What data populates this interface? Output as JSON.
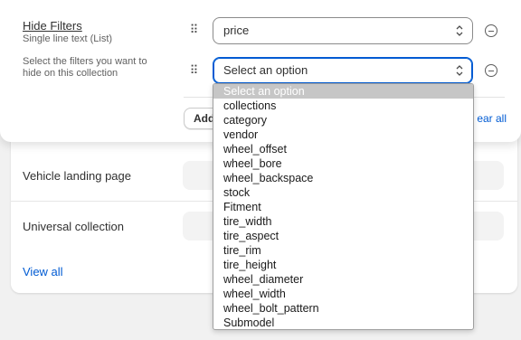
{
  "background": {
    "rows": [
      {
        "label": "Vehicle landing page"
      },
      {
        "label": "Universal collection"
      }
    ],
    "view_all": "View all"
  },
  "panel": {
    "title": "Hide Filters",
    "subtitle": "Single line text (List)",
    "description": "Select the filters you want to hide on this collection",
    "selects": [
      {
        "value": "price"
      },
      {
        "value": "Select an option"
      }
    ],
    "add_label": "Add",
    "clear_label": "ear all"
  },
  "dropdown": {
    "selected_index": 0,
    "options": [
      "Select an option",
      "collections",
      "category",
      "vendor",
      "wheel_offset",
      "wheel_bore",
      "wheel_backspace",
      "stock",
      "Fitment",
      "tire_width",
      "tire_aspect",
      "tire_rim",
      "tire_height",
      "wheel_diameter",
      "wheel_width",
      "wheel_bolt_pattern",
      "Submodel"
    ]
  },
  "colors": {
    "accent": "#005bd3",
    "selected_option_bg": "#c6c6c6"
  }
}
